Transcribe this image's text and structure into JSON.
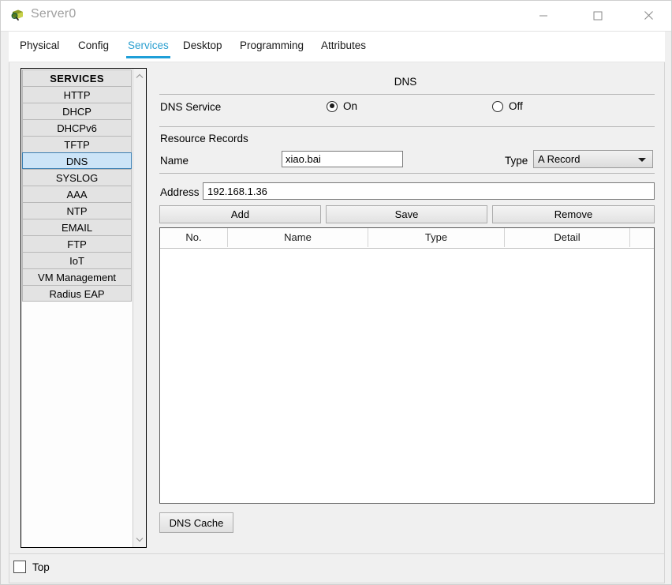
{
  "window": {
    "title": "Server0",
    "icon": "server-device-icon",
    "controls": {
      "minimize": "minimize-icon",
      "maximize": "maximize-icon",
      "close": "close-icon"
    }
  },
  "tabs": [
    {
      "label": "Physical",
      "active": false
    },
    {
      "label": "Config",
      "active": false
    },
    {
      "label": "Services",
      "active": true
    },
    {
      "label": "Desktop",
      "active": false
    },
    {
      "label": "Programming",
      "active": false
    },
    {
      "label": "Attributes",
      "active": false
    }
  ],
  "sidebar": {
    "header": "SERVICES",
    "selected": "DNS",
    "items": [
      {
        "label": "HTTP"
      },
      {
        "label": "DHCP"
      },
      {
        "label": "DHCPv6"
      },
      {
        "label": "TFTP"
      },
      {
        "label": "DNS"
      },
      {
        "label": "SYSLOG"
      },
      {
        "label": "AAA"
      },
      {
        "label": "NTP"
      },
      {
        "label": "EMAIL"
      },
      {
        "label": "FTP"
      },
      {
        "label": "IoT"
      },
      {
        "label": "VM Management"
      },
      {
        "label": "Radius EAP"
      }
    ],
    "scroll_up": "chevron-up-icon",
    "scroll_down": "chevron-down-icon"
  },
  "main": {
    "title": "DNS",
    "service": {
      "label": "DNS Service",
      "on_label": "On",
      "off_label": "Off",
      "selected": "On"
    },
    "resource_records": {
      "section_label": "Resource Records",
      "name_label": "Name",
      "name_value": "xiao.bai",
      "name_placeholder": "",
      "type_label": "Type",
      "type_value": "A Record",
      "address_label": "Address",
      "address_value": "192.168.1.36",
      "address_placeholder": ""
    },
    "buttons": {
      "add": "Add",
      "save": "Save",
      "remove": "Remove",
      "dns_cache": "DNS Cache"
    },
    "table": {
      "columns": [
        "No.",
        "Name",
        "Type",
        "Detail"
      ],
      "rows": []
    }
  },
  "footer": {
    "top_checkbox_label": "Top",
    "top_checked": false
  },
  "colors": {
    "accent": "#1e9fd8",
    "selection": "#cce4f7",
    "selection_border": "#3c7fb1",
    "panel": "#f0f0f0",
    "button": "#e2e2e2"
  }
}
